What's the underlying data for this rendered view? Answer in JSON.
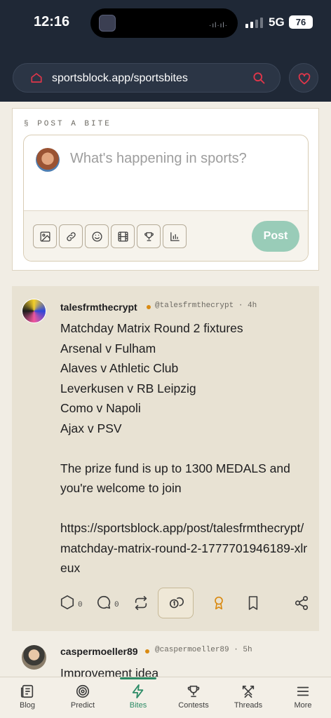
{
  "status_bar": {
    "time": "12:16",
    "network": "5G",
    "battery": "76"
  },
  "browser": {
    "url": "sportsblock.app/sportsbites"
  },
  "composer": {
    "section_label": "§ POST A BITE",
    "placeholder": "What's happening in sports?",
    "post_label": "Post",
    "tools": [
      "image-icon",
      "link-icon",
      "emoji-icon",
      "film-icon",
      "trophy-icon",
      "poll-icon"
    ]
  },
  "posts": [
    {
      "username": "talesfrmthecrypt",
      "handle": "@talesfrmthecrypt · 4h",
      "lines": [
        "Matchday Matrix Round 2 fixtures",
        "Arsenal v Fulham",
        "Alaves v Athletic Club",
        "Leverkusen v RB Leipzig",
        "Como v Napoli",
        "Ajax v PSV",
        "",
        "The prize fund is up to 1300 MEDALS and you're welcome to join",
        "",
        "https://sportsblock.app/post/talesfrmthecrypt/matchday-matrix-round-2-1777701946189-xlreux"
      ],
      "votes": "0",
      "comments": "0"
    },
    {
      "username": "caspermoeller89",
      "handle": "@caspermoeller89 · 5h",
      "first_line": "Improvement idea"
    }
  ],
  "tabs": [
    {
      "label": "Blog",
      "icon": "blog-icon"
    },
    {
      "label": "Predict",
      "icon": "target-icon"
    },
    {
      "label": "Bites",
      "icon": "bolt-icon"
    },
    {
      "label": "Contests",
      "icon": "trophy-icon"
    },
    {
      "label": "Threads",
      "icon": "swords-icon"
    },
    {
      "label": "More",
      "icon": "menu-icon"
    }
  ],
  "active_tab": "Bites",
  "colors": {
    "accent": "#2c8b66",
    "header": "#1f2836",
    "brand_red": "#e0364a",
    "medal": "#d98a12"
  }
}
